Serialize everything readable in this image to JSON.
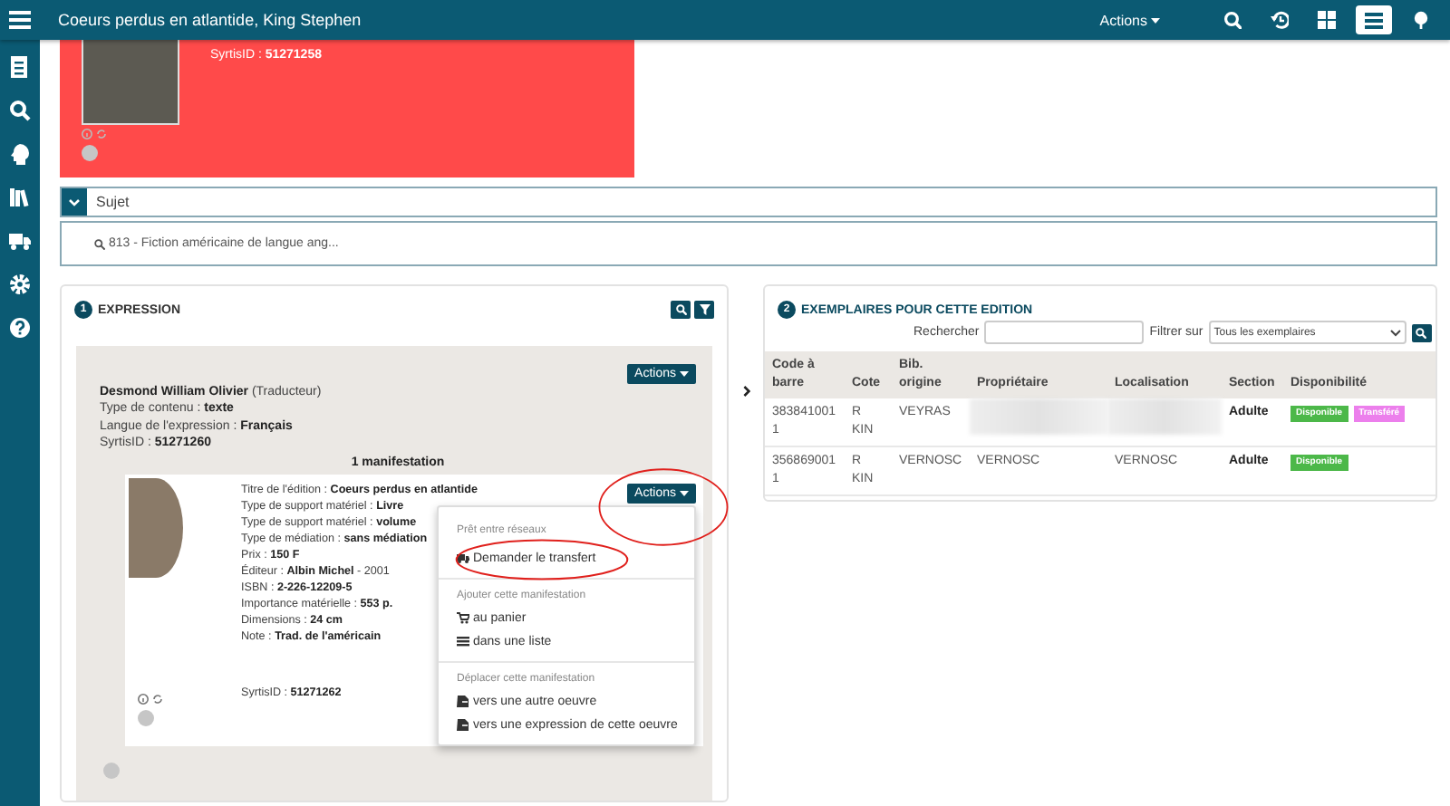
{
  "topbar": {
    "title": "Coeurs perdus en atlantide, King Stephen",
    "actions": "Actions",
    "view_buttons": [
      {
        "selected": false
      },
      {
        "selected": false
      },
      {
        "selected": false
      },
      {
        "selected": true
      },
      {
        "selected": false
      }
    ]
  },
  "record": {
    "syrtis": "SyrtisID : **51271258**"
  },
  "subject": {
    "expanded": true,
    "label": "Sujet",
    "entry": "813 - Fiction américaine de langue ang..."
  },
  "expression": {
    "number": "1",
    "title": "EXPRESSION",
    "actions": "Actions",
    "lines": [
      "**Desmond William Olivier** (Traducteur)",
      "Type de contenu : **texte**",
      "Langue de l'expression : **Français**",
      "SyrtisID : **51271260**"
    ],
    "count": "1 manifestation",
    "manifestation": {
      "actions": "Actions",
      "lines": [
        "Titre de l'édition : **Coeurs perdus en atlantide**",
        "Type de support matériel : **Livre**",
        "Type de support matériel : **volume**",
        "Type de médiation : **sans médiation**",
        "Prix : **150 F**",
        "Éditeur : **Albin Michel** - 2001",
        "ISBN : **2-226-12209-5**",
        "Importance matérielle : **553 p.**",
        "Dimensions : **24 cm**",
        "Note : **Trad. de l'américain**"
      ],
      "syrtis": "SyrtisID : **51271262**",
      "menu": [
        {
          "header": "Prêt entre réseaux",
          "items": [
            {
              "kind": "truck",
              "label": "Demander le transfert"
            }
          ]
        },
        {
          "header": "Ajouter cette manifestation",
          "items": [
            {
              "kind": "cart",
              "label": "au panier"
            },
            {
              "kind": "list",
              "label": "dans une liste"
            }
          ]
        },
        {
          "header": "Déplacer cette manifestation",
          "items": [
            {
              "kind": "doc",
              "label": "vers une autre oeuvre"
            },
            {
              "kind": "doc",
              "label": "vers une expression de cette oeuvre"
            }
          ]
        }
      ]
    }
  },
  "copies": {
    "number": "2",
    "title": "EXEMPLAIRES POUR CETTE EDITION",
    "search_label": "Rechercher",
    "filter_label": "Filtrer sur",
    "filter_value": "Tous les exemplaires",
    "columns": [
      "Code à barre",
      "Cote",
      "Bib. origine",
      "Propriétaire",
      "Localisation",
      "Section",
      "Disponibilité"
    ],
    "rows": [
      {
        "barcode": "3838410011",
        "cote": "R KIN",
        "origin": "VEYRAS",
        "redacted": true,
        "section": "Adulte",
        "badges": [
          {
            "label": "Disponible",
            "color": "#4cb849"
          },
          {
            "label": "Transféré",
            "color": "#ec7fec"
          }
        ]
      },
      {
        "barcode": "3568690011",
        "cote": "R KIN",
        "origin": "VERNOSC",
        "redacted": false,
        "owner": "VERNOSC",
        "location": "VERNOSC",
        "section": "Adulte",
        "badges": [
          {
            "label": "Disponible",
            "color": "#4cb849"
          }
        ]
      }
    ]
  }
}
